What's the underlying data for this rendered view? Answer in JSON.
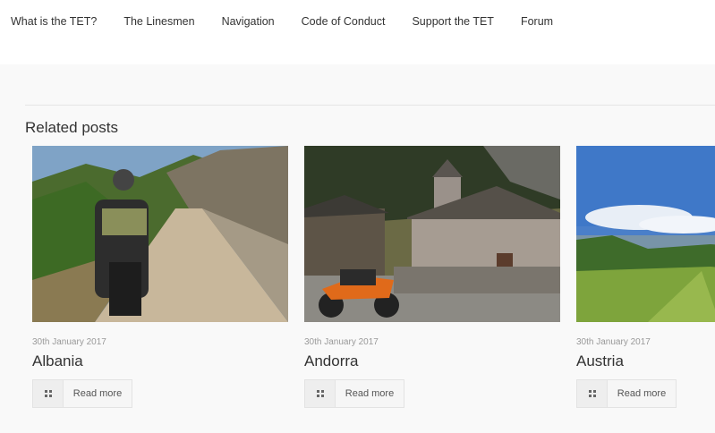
{
  "nav": {
    "items": [
      "What is the TET?",
      "The Linesmen",
      "Navigation",
      "Code of Conduct",
      "Support the TET",
      "Forum"
    ]
  },
  "related": {
    "title": "Related posts",
    "posts": [
      {
        "date": "30th January 2017",
        "title": "Albania",
        "button": "Read more"
      },
      {
        "date": "30th January 2017",
        "title": "Andorra",
        "button": "Read more"
      },
      {
        "date": "30th January 2017",
        "title": "Austria",
        "button": "Read more"
      }
    ]
  },
  "icons": {
    "readmore": "grid-icon"
  },
  "colors": {
    "background": "#f9f9f9",
    "nav_bg": "#ffffff",
    "text": "#333333",
    "meta": "#999999"
  }
}
